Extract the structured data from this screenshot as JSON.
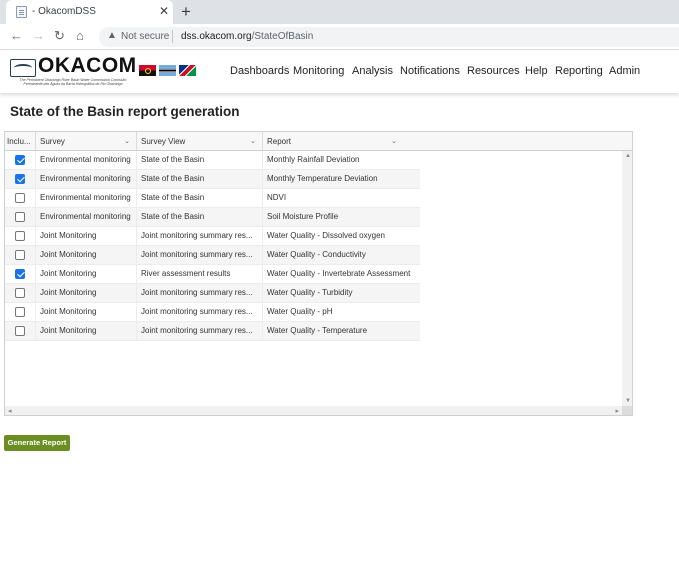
{
  "browser": {
    "tab_title": "- OkacomDSS",
    "close_glyph": "✕",
    "new_tab_glyph": "+",
    "back_glyph": "←",
    "forward_glyph": "→",
    "reload_glyph": "↻",
    "home_glyph": "⌂",
    "security_glyph": "▲",
    "security_label": "Not secure",
    "url_host": "dss.okacom.org",
    "url_path": "/StateOfBasin"
  },
  "header": {
    "logo_text": "OKACOM",
    "logo_subtitle": "The Permanent Okavango River Basin Water Commission Comissão Permanente das Águas da Bacia Hidrográfica do Rio Okavango",
    "nav": [
      "Dashboards",
      "Monitoring",
      "Analysis",
      "Notifications",
      "Resources",
      "Help",
      "Reporting",
      "Admin"
    ]
  },
  "main": {
    "title": "State of the Basin report generation",
    "columns": [
      "Inclu...",
      "Survey",
      "Survey View",
      "Report"
    ],
    "caret_glyph": "⌄",
    "rows": [
      {
        "include": true,
        "survey": "Environmental monitoring",
        "view": "State of the Basin",
        "report": "Monthly Rainfall Deviation"
      },
      {
        "include": true,
        "survey": "Environmental monitoring",
        "view": "State of the Basin",
        "report": "Monthly Temperature Deviation"
      },
      {
        "include": false,
        "survey": "Environmental monitoring",
        "view": "State of the Basin",
        "report": "NDVI"
      },
      {
        "include": false,
        "survey": "Environmental monitoring",
        "view": "State of the Basin",
        "report": "Soil Moisture Profile"
      },
      {
        "include": false,
        "survey": "Joint Monitoring",
        "view": "Joint monitoring summary res...",
        "report": "Water Quality - Dissolved oxygen"
      },
      {
        "include": false,
        "survey": "Joint Monitoring",
        "view": "Joint monitoring summary res...",
        "report": "Water Quality - Conductivity"
      },
      {
        "include": true,
        "survey": "Joint Monitoring",
        "view": "River assessment results",
        "report": "Water Quality - Invertebrate Assessment"
      },
      {
        "include": false,
        "survey": "Joint Monitoring",
        "view": "Joint monitoring summary res...",
        "report": "Water Quality - Turbidity"
      },
      {
        "include": false,
        "survey": "Joint Monitoring",
        "view": "Joint monitoring summary res...",
        "report": "Water Quality - pH"
      },
      {
        "include": false,
        "survey": "Joint Monitoring",
        "view": "Joint monitoring summary res...",
        "report": "Water Quality - Temperature"
      }
    ],
    "scroll_up_glyph": "▲",
    "scroll_down_glyph": "▼",
    "scroll_left_glyph": "◂",
    "scroll_right_glyph": "▸",
    "generate_label": "Generate Report",
    "accent_color": "#6b8e23",
    "checkbox_color": "#1a73e8"
  }
}
